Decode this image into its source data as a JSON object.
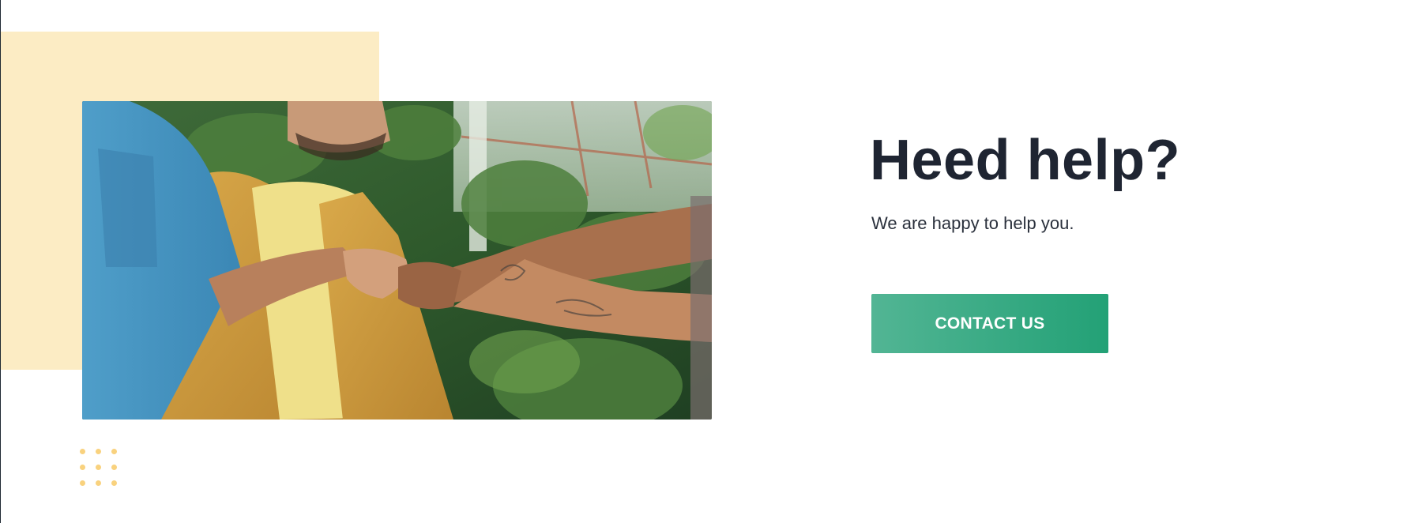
{
  "hero": {
    "title": "Heed help?",
    "subtitle": "We are happy to help you.",
    "cta_label": "CONTACT US"
  },
  "photo": {
    "description_icon": "team-fist-bump-photo"
  },
  "colors": {
    "accent_yellow": "#fcecc4",
    "dots_yellow": "#f9d27e",
    "button_green_start": "#52b594",
    "button_green_end": "#23a176",
    "title_text": "#1f2532"
  }
}
